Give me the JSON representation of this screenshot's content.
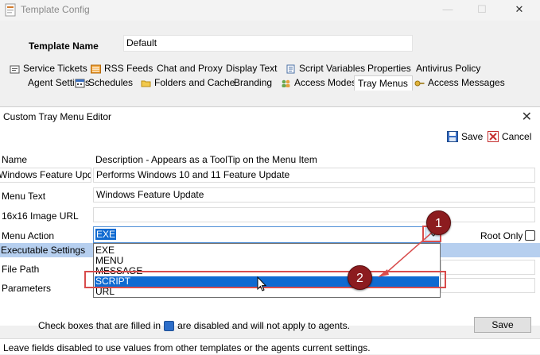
{
  "window": {
    "title": "Template Config"
  },
  "template": {
    "label": "Template Name",
    "value": "Default"
  },
  "tabs_row1": [
    "Service Tickets",
    "RSS Feeds",
    "Chat and Proxy",
    "Display Text",
    "Script Variables",
    "Properties",
    "Antivirus Policy"
  ],
  "tabs_row2": [
    "Agent Settings",
    "Schedules",
    "Folders and Cache",
    "Branding",
    "Access Modes",
    "Tray Menus",
    "Access Messages"
  ],
  "active_tab": "Tray Menus",
  "dialog": {
    "title": "Custom Tray Menu Editor",
    "save_label": "Save",
    "cancel_label": "Cancel",
    "header_name": "Name",
    "header_desc": "Description - Appears as a ToolTip on the Menu Item",
    "item_name": "Windows Feature Update",
    "item_desc": "Performs Windows 10 and 11 Feature Update",
    "menu_text_label": "Menu Text",
    "menu_text_value": "Windows Feature Update",
    "image_url_label": "16x16 Image URL",
    "image_url_value": "",
    "menu_action_label": "Menu Action",
    "menu_action_value": "EXE",
    "root_only_label": "Root Only",
    "exec_settings_label": "Executable Settings",
    "file_path_label": "File Path",
    "parameters_label": "Parameters",
    "dropdown_options": [
      "EXE",
      "MENU",
      "MESSAGE",
      "SCRIPT",
      "URL"
    ],
    "dropdown_highlighted": "SCRIPT",
    "footer_note_before": "Check boxes that are filled in",
    "footer_note_after": "are disabled and will not apply to agents.",
    "footer_save_label": "Save",
    "status_text": "Leave fields disabled to use values from other templates or the agents current settings."
  },
  "callouts": [
    "1",
    "2"
  ],
  "colors": {
    "selection": "#0f6ad1",
    "exec_row": "#b6cfef",
    "callout": "#8c1c1f",
    "callout_outline": "#d84c4c"
  }
}
